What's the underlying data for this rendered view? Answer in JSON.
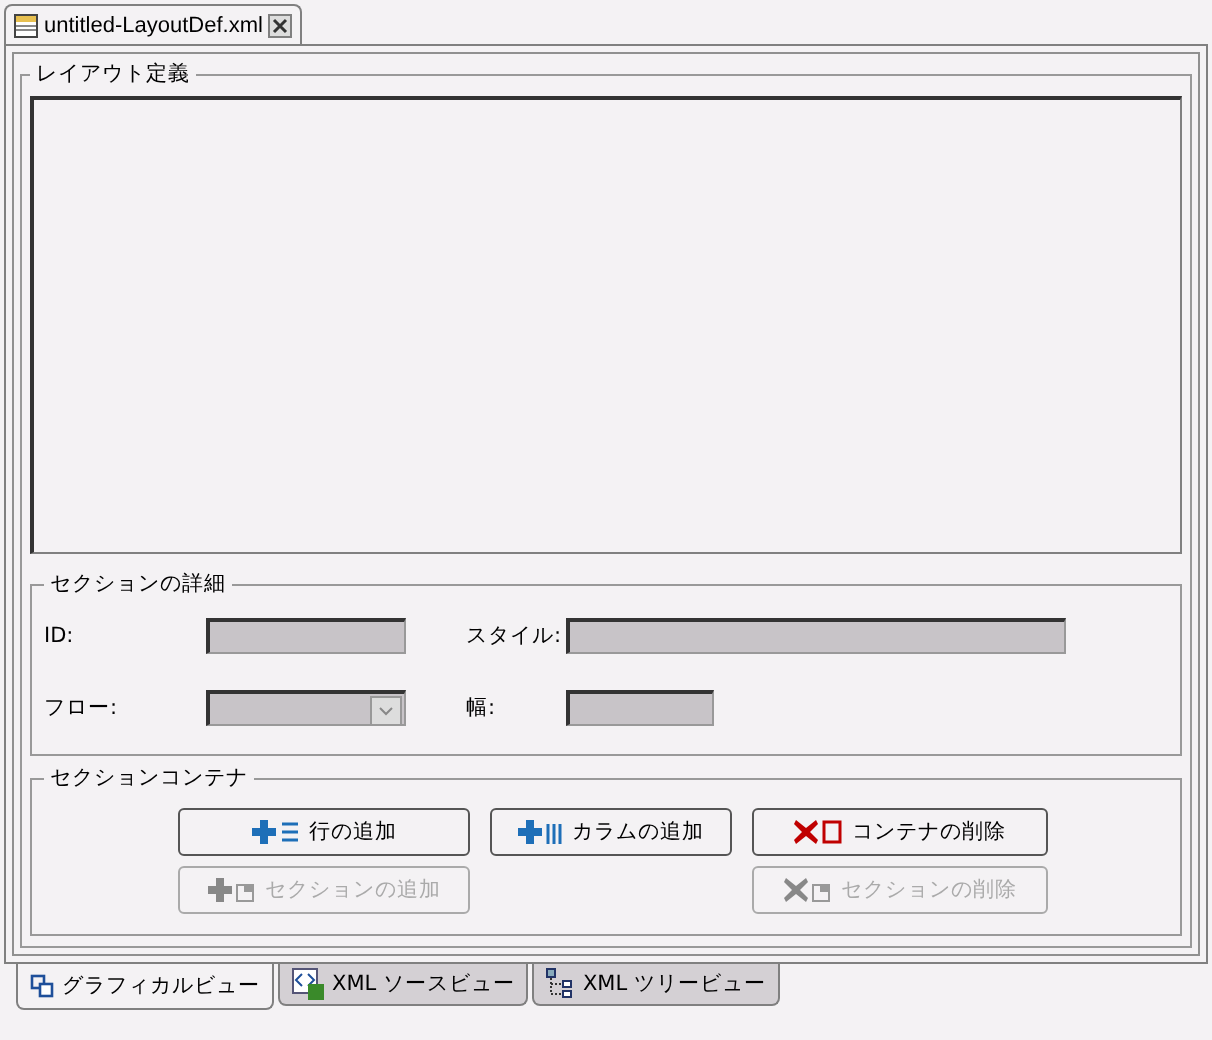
{
  "editor_tab": {
    "title": "untitled-LayoutDef.xml"
  },
  "layout_definition": {
    "title": "レイアウト定義"
  },
  "section_details": {
    "title": "セクションの詳細",
    "fields": [
      {
        "label": "ID:",
        "kind": "text",
        "disabled": true
      },
      {
        "label": "スタイル:",
        "kind": "text",
        "disabled": true
      },
      {
        "label": "フロー:",
        "kind": "select",
        "disabled": true
      },
      {
        "label": "幅:",
        "kind": "text",
        "disabled": true
      }
    ]
  },
  "section_container": {
    "title": "セクションコンテナ",
    "buttons": [
      {
        "label": "行の追加",
        "disabled": false
      },
      {
        "label": "カラムの追加",
        "disabled": false
      },
      {
        "label": "コンテナの削除",
        "disabled": false
      },
      {
        "label": "セクションの追加",
        "disabled": true
      },
      {
        "label": "セクションの削除",
        "disabled": true
      }
    ]
  },
  "view_tabs": [
    {
      "label": "グラフィカルビュー",
      "selected": true
    },
    {
      "label": "XML ソースビュー",
      "selected": false
    },
    {
      "label": "XML ツリービュー",
      "selected": false
    }
  ]
}
